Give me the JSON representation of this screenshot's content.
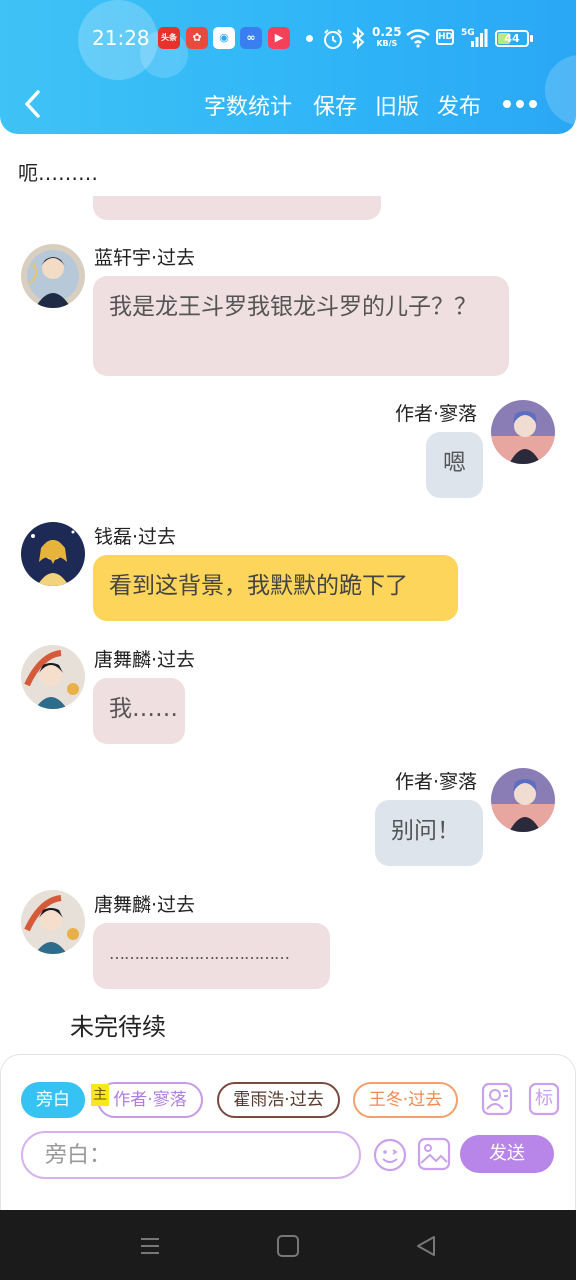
{
  "status_bar": {
    "time": "21:28",
    "net_speed_value": "0.25",
    "net_speed_unit": "KB/S",
    "hd_label": "HD",
    "network_label": "5G",
    "battery_level": "44",
    "battery_fraction": 0.44
  },
  "nav": {
    "back_icon": "chevron-left-icon",
    "word_count": "字数统计",
    "save": "保存",
    "old_version": "旧版",
    "publish": "发布",
    "more_icon": "more-dots-icon"
  },
  "intro_text": "呃………",
  "messages": [
    {
      "side": "left",
      "name": "蓝轩宇·过去",
      "text": "我是龙王斗罗我银龙斗罗的儿子？？",
      "style": "pink"
    },
    {
      "side": "right",
      "name": "作者·寥落",
      "text": "嗯",
      "style": "gray"
    },
    {
      "side": "left",
      "name": "钱磊·过去",
      "text": "看到这背景，我默默的跪下了",
      "style": "yellow"
    },
    {
      "side": "left",
      "name": "唐舞麟·过去",
      "text": "我……",
      "style": "pink"
    },
    {
      "side": "right",
      "name": "作者·寥落",
      "text": "别问！",
      "style": "gray"
    },
    {
      "side": "left",
      "name": "唐舞麟·过去",
      "text": "………………………………",
      "style": "pink"
    }
  ],
  "tbc_text": "未完待续",
  "composer": {
    "chips": [
      "旁白",
      "作者·寥落",
      "霍雨浩·过去",
      "王冬·过去"
    ],
    "zhu_tag": "主",
    "role_icon": "person-card-icon",
    "tag_icon": "tag-biao-icon",
    "tag_label": "标",
    "input_placeholder": "旁白：",
    "emoji_icon": "smiley-icon",
    "image_icon": "image-icon",
    "send": "发送"
  },
  "colors": {
    "header": "#2fb4f7",
    "accent_purple": "#b885e8",
    "bubble_pink": "#f0dfe1",
    "bubble_gray": "#dde4ec",
    "bubble_yellow": "#fdd55a"
  }
}
